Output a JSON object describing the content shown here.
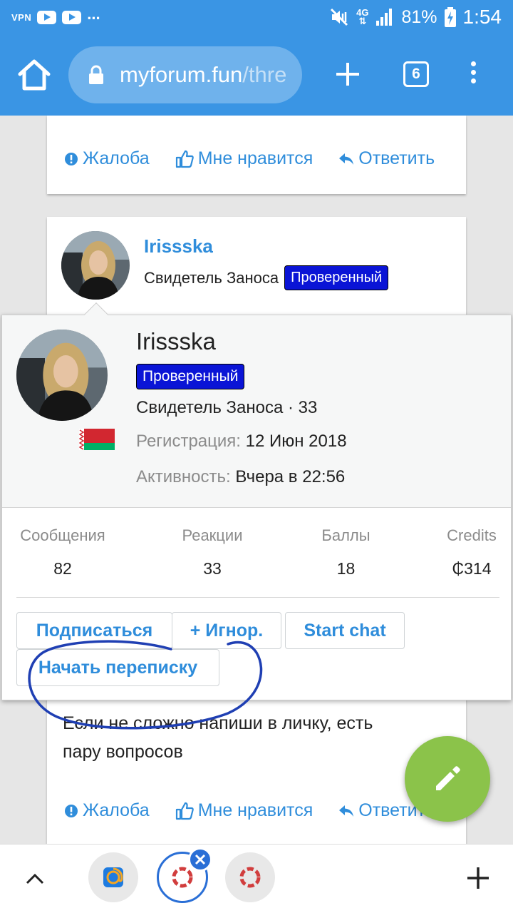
{
  "status_bar": {
    "vpn": "VPN",
    "dots": "...",
    "network": "4G",
    "battery": "81%",
    "time": "1:54"
  },
  "browser": {
    "url_domain": "myforum.fun",
    "url_path": "/thre",
    "tab_count": "6",
    "icons": [
      "home-icon",
      "lock-icon",
      "new-tab-icon",
      "tabs-icon",
      "overflow-menu-icon"
    ]
  },
  "post_top": {
    "actions": {
      "report": "Жалоба",
      "like": "Мне нравится",
      "reply": "Ответить"
    }
  },
  "post_main": {
    "username": "Irissska",
    "user_title": "Свидетель Заноса",
    "badge": "Проверенный",
    "text_line1": "Если не сложно напиши в личку, есть",
    "text_line2": "пару вопросов",
    "actions": {
      "report": "Жалоба",
      "like": "Мне нравится",
      "reply": "Ответить"
    }
  },
  "profile_popup": {
    "username": "Irissska",
    "badge": "Проверенный",
    "title_line": "Свидетель Заноса · 33",
    "registration_label": "Регистрация:",
    "registration_value": "12 Июн 2018",
    "activity_label": "Активность:",
    "activity_value": "Вчера в 22:56",
    "stats": [
      {
        "label": "Сообщения",
        "value": "82"
      },
      {
        "label": "Реакции",
        "value": "33"
      },
      {
        "label": "Баллы",
        "value": "18"
      },
      {
        "label": "Credits",
        "value": "₵314"
      }
    ],
    "buttons": {
      "follow": "Подписаться",
      "ignore": "+ Игнор.",
      "start_chat": "Start chat",
      "start_conversation": "Начать переписку"
    }
  },
  "colors": {
    "toolbar": "#3a95e4",
    "link": "#2f8ddb",
    "badge": "#0a14d6",
    "fab": "#8bc34a",
    "scribble": "#1f3fb3"
  }
}
